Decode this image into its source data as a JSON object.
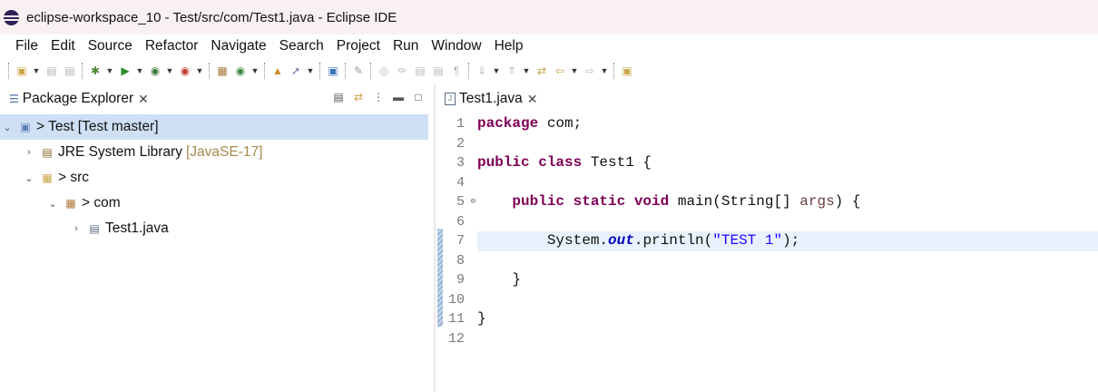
{
  "window": {
    "title": "eclipse-workspace_10 - Test/src/com/Test1.java - Eclipse IDE"
  },
  "menu": [
    "File",
    "Edit",
    "Source",
    "Refactor",
    "Navigate",
    "Search",
    "Project",
    "Run",
    "Window",
    "Help"
  ],
  "package_explorer": {
    "tab_label": "Package Explorer",
    "tree": {
      "project": "> Test [Test master]",
      "jre": "JRE System Library",
      "jre_version": "[JavaSE-17]",
      "src": "> src",
      "package": "> com",
      "file": "Test1.java"
    }
  },
  "editor": {
    "tab_label": "Test1.java",
    "line_numbers": [
      "1",
      "2",
      "3",
      "4",
      "5",
      "6",
      "7",
      "8",
      "9",
      "10",
      "11",
      "12"
    ],
    "code": {
      "l1_kw": "package",
      "l1_rest": " com;",
      "l3_kw": "public class",
      "l3_rest": " Test1 {",
      "l5_indent": "    ",
      "l5_kw": "public static void",
      "l5_mid": " main(String[] ",
      "l5_param": "args",
      "l5_end": ") {",
      "l7_indent": "        System.",
      "l7_field": "out",
      "l7_mid": ".println(",
      "l7_str": "\"TEST 1\"",
      "l7_end": ");",
      "l9": "    }",
      "l11": "}"
    }
  },
  "colors": {
    "keyword": "#7f0055",
    "string": "#2a00ff",
    "field": "#0000c0",
    "selection": "#cfe0f4",
    "current_line": "#e8f2fe"
  }
}
